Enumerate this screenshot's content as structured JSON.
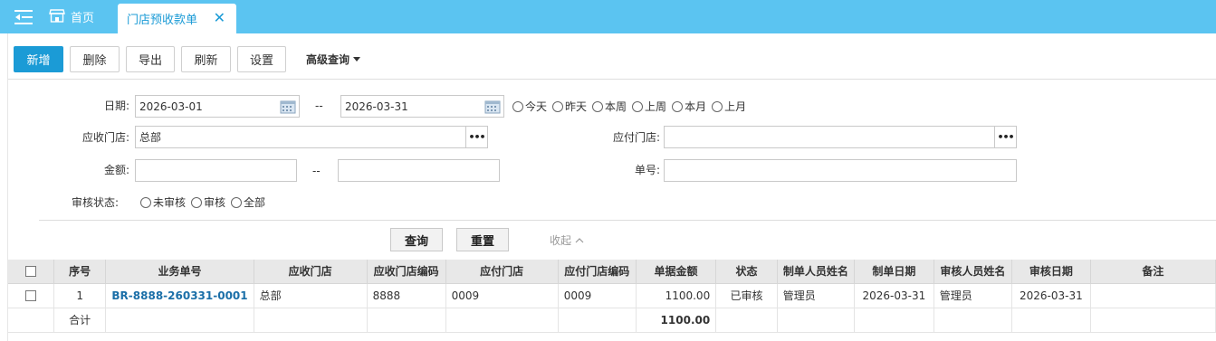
{
  "tabs": {
    "home": "首页",
    "active": "门店预收款单",
    "close": "✕"
  },
  "toolbar": {
    "add": "新增",
    "delete": "删除",
    "export": "导出",
    "refresh": "刷新",
    "settings": "设置",
    "advanced": "高级查询"
  },
  "form": {
    "date_label": "日期:",
    "date_from": "2026-03-01",
    "date_sep": "--",
    "date_to": "2026-03-31",
    "quick_dates": [
      "今天",
      "昨天",
      "本周",
      "上周",
      "本月",
      "上月"
    ],
    "receive_store_label": "应收门店:",
    "receive_store_value": "总部",
    "pay_store_label": "应付门店:",
    "pay_store_value": "",
    "amount_label": "金额:",
    "amount_from": "",
    "amount_sep": "--",
    "amount_to": "",
    "doc_no_label": "单号:",
    "doc_no_value": "",
    "audit_label": "审核状态:",
    "audit_options": [
      "未审核",
      "审核",
      "全部"
    ],
    "lookup_icon": "•••",
    "search": "查询",
    "reset": "重置",
    "collapse": "收起"
  },
  "table": {
    "headers": [
      "序号",
      "业务单号",
      "应收门店",
      "应收门店编码",
      "应付门店",
      "应付门店编码",
      "单据金额",
      "状态",
      "制单人员姓名",
      "制单日期",
      "审核人员姓名",
      "审核日期",
      "备注"
    ],
    "rows": [
      {
        "seq": "1",
        "doc_no": "BR-8888-260331-0001",
        "receive_store": "总部",
        "receive_code": "8888",
        "pay_store": "0009",
        "pay_code": "0009",
        "amount": "1100.00",
        "status": "已审核",
        "creator": "管理员",
        "create_date": "2026-03-31",
        "auditor": "管理员",
        "audit_date": "2026-03-31",
        "remark": ""
      }
    ],
    "total_label": "合计",
    "total_amount": "1100.00"
  },
  "colors": {
    "topbar": "#5bc4f1",
    "primary": "#1b9bd6",
    "link": "#1b6fa8"
  }
}
